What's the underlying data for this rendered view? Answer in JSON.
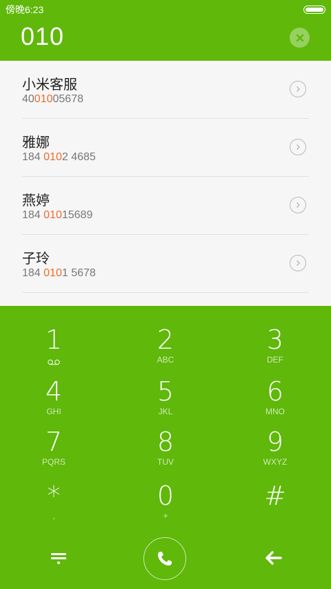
{
  "status_bar": {
    "time": "傍晚6:23"
  },
  "dial_input": {
    "number": "010"
  },
  "contacts": [
    {
      "name": "小米客服",
      "phone_pre": "40",
      "phone_hl": "010",
      "phone_post": "05678"
    },
    {
      "name": "雅娜",
      "phone_pre": "184 ",
      "phone_hl": "010",
      "phone_post": "2 4685"
    },
    {
      "name": "燕婷",
      "phone_pre": "184 ",
      "phone_hl": "010",
      "phone_post": "15689"
    },
    {
      "name": "子玲",
      "phone_pre": "184 ",
      "phone_hl": "010",
      "phone_post": "1 5678"
    }
  ],
  "keypad": [
    {
      "digit": "1",
      "letters": ""
    },
    {
      "digit": "2",
      "letters": "ABC"
    },
    {
      "digit": "3",
      "letters": "DEF"
    },
    {
      "digit": "4",
      "letters": "GHI"
    },
    {
      "digit": "5",
      "letters": "JKL"
    },
    {
      "digit": "6",
      "letters": "MNO"
    },
    {
      "digit": "7",
      "letters": "PQRS"
    },
    {
      "digit": "8",
      "letters": "TUV"
    },
    {
      "digit": "9",
      "letters": "WXYZ"
    },
    {
      "digit": "*",
      "letters": ","
    },
    {
      "digit": "0",
      "letters": "+"
    },
    {
      "digit": "#",
      "letters": ""
    }
  ],
  "colors": {
    "accent": "#5fb80a",
    "highlight": "#f06a2a",
    "list_bg": "#f6f6f6"
  },
  "icons": {
    "clear": "close-icon",
    "contact_detail": "chevron-right-icon",
    "voicemail": "voicemail-icon",
    "menu": "menu-icon",
    "call": "phone-icon",
    "back": "backspace-icon"
  }
}
